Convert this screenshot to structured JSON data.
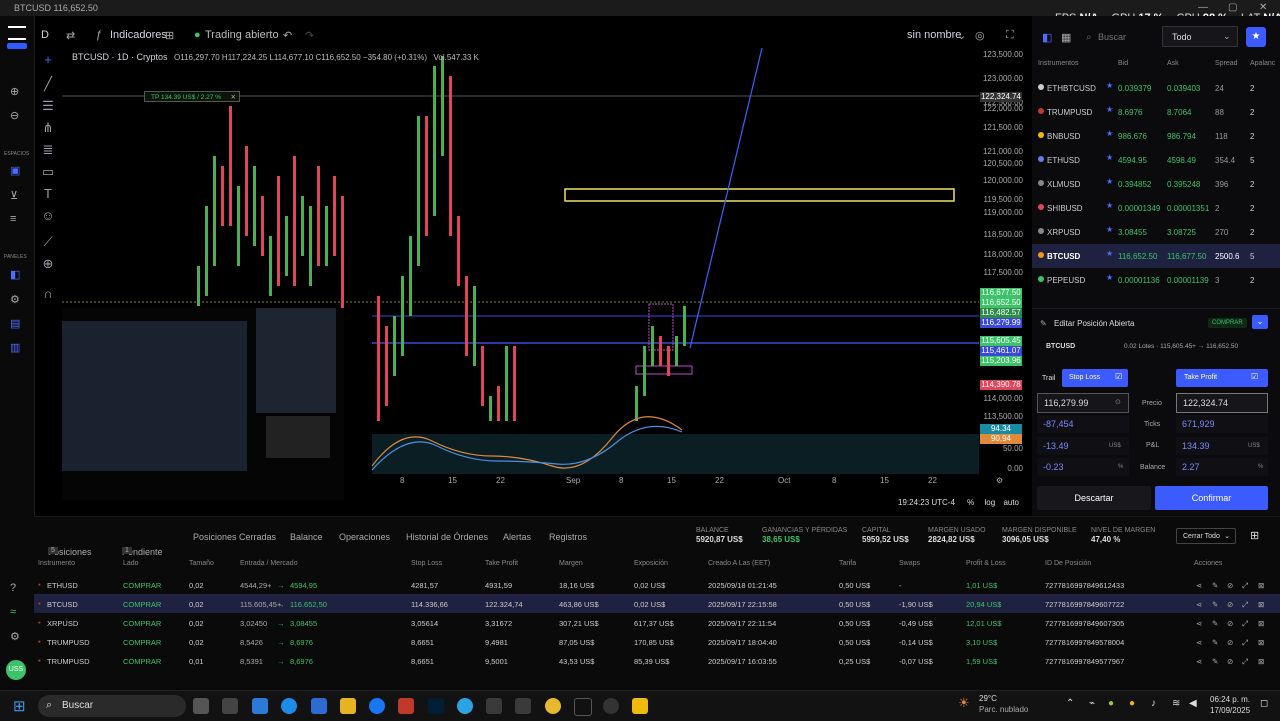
{
  "window": {
    "title": "BTCUSD 116,652.50"
  },
  "stats": {
    "fps_label": "FPS",
    "fps": "N/A",
    "gpu_label": "GPU",
    "gpu": "17 %",
    "cpu_label": "CPU",
    "cpu": "98 %",
    "lat_label": "LAT",
    "lat": "N/A"
  },
  "toolbar": {
    "interval": "D",
    "indicators": "Indicadores",
    "trading": "Trading abierto",
    "layout": "sin nombre"
  },
  "legend": {
    "symbol": "BTCUSD · 1D · Cryptos",
    "ohlc": "O116,297.70 H117,224.25 L114,677.10 C116,652.50 −354.80 (+0.31%)",
    "vol": "Vol.547.33 K"
  },
  "tp_label": "TP 134.39 US$ / 2.27 %",
  "price_axis": [
    "123,500.00",
    "123,000.00",
    "122,500.00",
    "122,000.00",
    "121,500.00",
    "121,000.00",
    "120,500.00",
    "120,000.00",
    "119,500.00",
    "119,000.00",
    "118,500.00",
    "118,000.00",
    "117,500.00",
    "114,000.00",
    "113,500.00"
  ],
  "price_tags": {
    "tp": "122,324.74",
    "t1": "116,677.50",
    "t2": "116,652.50",
    "t3": "116,482.57",
    "t4": "116,279.99",
    "t5": "115,605.45",
    "t6": "115,461.07",
    "t7": "115,203.96",
    "t8": "114,390.78",
    "osc1": "94.34",
    "osc2": "90.94",
    "osc3": "50.00",
    "osc4": "0.00"
  },
  "time_axis": [
    "8",
    "15",
    "22",
    "Sep",
    "8",
    "15",
    "22",
    "Oct",
    "8",
    "15",
    "22"
  ],
  "chart_footer": {
    "time": "19:24:23 UTC-4",
    "pct": "%",
    "log": "log",
    "auto": "auto"
  },
  "search": {
    "placeholder": "Buscar",
    "filter": "Todo"
  },
  "instruments": {
    "headers": [
      "Instrumentos",
      "Bid",
      "Ask",
      "Spread",
      "Apalanc"
    ],
    "rows": [
      {
        "name": "ETHBTCUSD",
        "bid": "0.039379",
        "ask": "0.039403",
        "spread": "24",
        "lev": "2",
        "color": "#cccccc"
      },
      {
        "name": "TRUMPUSD",
        "bid": "8.6976",
        "ask": "8.7064",
        "spread": "88",
        "lev": "2",
        "color": "#c0392b"
      },
      {
        "name": "BNBUSD",
        "bid": "986.676",
        "ask": "986.794",
        "spread": "118",
        "lev": "2",
        "color": "#f0b90b"
      },
      {
        "name": "ETHUSD",
        "bid": "4594.95",
        "ask": "4598.49",
        "spread": "354.4",
        "lev": "5",
        "color": "#627eea"
      },
      {
        "name": "XLMUSD",
        "bid": "0.394852",
        "ask": "0.395248",
        "spread": "396",
        "lev": "2",
        "color": "#888888"
      },
      {
        "name": "SHIBUSD",
        "bid": "0.00001349",
        "ask": "0.00001351",
        "spread": "2",
        "lev": "2",
        "color": "#e0455a"
      },
      {
        "name": "XRPUSD",
        "bid": "3.08455",
        "ask": "3.08725",
        "spread": "270",
        "lev": "2",
        "color": "#888888"
      },
      {
        "name": "BTCUSD",
        "bid": "116,652.50",
        "ask": "116,677.50",
        "spread": "2500.6",
        "lev": "5",
        "color": "#f7931a"
      },
      {
        "name": "PEPEUSD",
        "bid": "0.00001136",
        "ask": "0.00001139",
        "spread": "3",
        "lev": "2",
        "color": "#3cc36a"
      }
    ]
  },
  "edit": {
    "title": "Editar Posición Abierta",
    "buy_badge": "COMPRAR",
    "symbol": "BTCUSD",
    "detail": "0.02 Lotes · 115,605.45+ → 116,652.50",
    "trail": "Trail",
    "stop_loss": "Stop Loss",
    "take_profit": "Take Profit",
    "sl_price": "116,279.99",
    "tp_price": "122,324.74",
    "price_label": "Precio",
    "sl_ticks": "-87,454",
    "tp_ticks": "671,929",
    "ticks_label": "Ticks",
    "sl_pl": "-13.49",
    "tp_pl": "134.39",
    "pl_label": "P&L",
    "usd": "US$",
    "sl_bal": "-0.23",
    "tp_bal": "2.27",
    "bal_label": "Balance",
    "pct": "%",
    "discard": "Descartar",
    "confirm": "Confirmar"
  },
  "tabs": {
    "positions": "Posiciones",
    "positions_count": "5",
    "pending": "Pendiente",
    "pending_count": "1",
    "closed": "Posiciones Cerradas",
    "balance": "Balance",
    "operations": "Operaciones",
    "history": "Historial de Órdenes",
    "alerts": "Alertas",
    "records": "Registros",
    "close_all": "Cerrar Todo"
  },
  "summary": [
    {
      "label": "BALANCE",
      "value": "5920,87 US$"
    },
    {
      "label": "GANANCIAS Y PÉRDIDAS",
      "value": "38,65 US$"
    },
    {
      "label": "CAPITAL",
      "value": "5959,52 US$"
    },
    {
      "label": "MARGEN USADO",
      "value": "2824,82 US$"
    },
    {
      "label": "MARGEN DISPONIBLE",
      "value": "3096,05 US$"
    },
    {
      "label": "NIVEL DE MARGEN",
      "value": "47,40 %"
    }
  ],
  "positions": {
    "headers": [
      "Instrumento",
      "Lado",
      "Tamaño",
      "Entrada / Mercado",
      "Stop Loss",
      "Take Profit",
      "Margen",
      "Exposición",
      "Creado A Las (EET)",
      "Tarifa",
      "Swaps",
      "Profit & Loss",
      "ID De Posición",
      "Acciones"
    ],
    "rows": [
      {
        "inst": "ETHUSD",
        "side": "COMPRAR",
        "size": "0,02",
        "entry": "4544,29+",
        "market": "4594,95",
        "sl": "4281,57",
        "tp": "4931,59",
        "margin": "18,16 US$",
        "exp": "0,02 US$",
        "created": "2025/09/18 01:21:45",
        "fee": "0,50 US$",
        "swaps": "-",
        "pl": "1,01 US$",
        "id": "7277816997849612433"
      },
      {
        "inst": "BTCUSD",
        "side": "COMPRAR",
        "size": "0,02",
        "entry": "115.605,45+",
        "market": "116.652,50",
        "sl": "114.336,66",
        "tp": "122.324,74",
        "margin": "463,86 US$",
        "exp": "0,02 US$",
        "created": "2025/09/17 22:15:58",
        "fee": "0,50 US$",
        "swaps": "-1,90 US$",
        "pl": "20,94 US$",
        "id": "7277816997849607722"
      },
      {
        "inst": "XRPUSD",
        "side": "COMPRAR",
        "size": "0,02",
        "entry": "3,02450",
        "market": "3,08455",
        "sl": "3,05614",
        "tp": "3,31672",
        "margin": "307,21 US$",
        "exp": "617,37 US$",
        "created": "2025/09/17 22:11:54",
        "fee": "0,50 US$",
        "swaps": "-0,49 US$",
        "pl": "12,01 US$",
        "id": "7277816997849607305"
      },
      {
        "inst": "TRUMPUSD",
        "side": "COMPRAR",
        "size": "0,02",
        "entry": "8,5426",
        "market": "8,6976",
        "sl": "8,6651",
        "tp": "9,4981",
        "margin": "87,05 US$",
        "exp": "170,85 US$",
        "created": "2025/09/17 18:04:40",
        "fee": "0,50 US$",
        "swaps": "-0,14 US$",
        "pl": "3,10 US$",
        "id": "7277816997849578004"
      },
      {
        "inst": "TRUMPUSD",
        "side": "COMPRAR",
        "size": "0,01",
        "entry": "8,5391",
        "market": "8,6976",
        "sl": "8,6651",
        "tp": "9,5001",
        "margin": "43,53 US$",
        "exp": "85,39 US$",
        "created": "2025/09/17 16:03:55",
        "fee": "0,25 US$",
        "swaps": "-0,07 US$",
        "pl": "1,59 US$",
        "id": "7277816997849577967"
      }
    ]
  },
  "taskbar": {
    "search": "Buscar",
    "weather_temp": "29°C",
    "weather_desc": "Parc. nublado",
    "time": "06:24 p. m.",
    "date": "17/09/2025"
  },
  "left_labels": {
    "spaces": "ESPACIOS",
    "panels": "PANELES",
    "user": "USS"
  }
}
